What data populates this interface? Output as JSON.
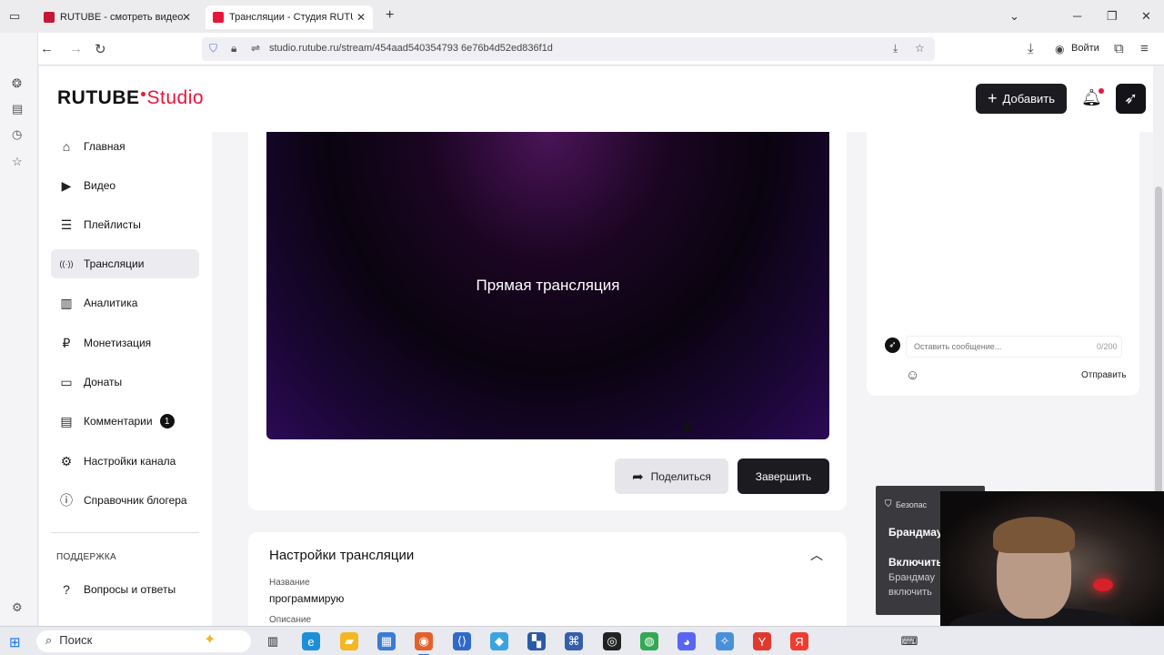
{
  "browser": {
    "tabs": [
      {
        "title": "RUTUBE - смотреть видео онл",
        "favicon_color": "#c61636"
      },
      {
        "title": "Трансляции - Студия RUTUBE",
        "favicon_color": "#ed143b"
      }
    ],
    "url": "studio.rutube.ru/stream/454aad540354793 6e76b4d52ed836f1d",
    "login_label": "Войти"
  },
  "header": {
    "logo_brand": "RUTUBE",
    "logo_product": "Studio",
    "add_label": "Добавить"
  },
  "sidebar": {
    "items": [
      {
        "label": "Главная",
        "icon": "⌂"
      },
      {
        "label": "Видео",
        "icon": "▶"
      },
      {
        "label": "Плейлисты",
        "icon": "☰"
      },
      {
        "label": "Трансляции",
        "icon": "((·))"
      },
      {
        "label": "Аналитика",
        "icon": "▥"
      },
      {
        "label": "Монетизация",
        "icon": "₽"
      },
      {
        "label": "Донаты",
        "icon": "▭"
      },
      {
        "label": "Комментарии",
        "icon": "▤",
        "badge": "1"
      },
      {
        "label": "Настройки канала",
        "icon": "⚙"
      },
      {
        "label": "Справочник блогера",
        "icon": "ⓘ"
      }
    ],
    "support_section": "ПОДДЕРЖКА",
    "support_items": [
      {
        "label": "Вопросы и ответы",
        "icon": "?"
      }
    ]
  },
  "player": {
    "title": "Прямая трансляция"
  },
  "actions": {
    "share_label": "Поделиться",
    "finish_label": "Завершить"
  },
  "settings": {
    "title": "Настройки трансляции",
    "name_label": "Название",
    "name_value": "программирую",
    "description_label": "Описание"
  },
  "chat": {
    "placeholder": "Оставить сообщение...",
    "counter": "0/200",
    "send_label": "Отправить"
  },
  "notification": {
    "line1": "Безопас",
    "line2": "Брандмау",
    "line3": "Включить",
    "line4": "Брандмау",
    "line5": "включить"
  },
  "taskbar": {
    "search_label": "Поиск"
  },
  "colors": {
    "brand_red": "#ed143b",
    "dark_button": "#1c1c20"
  }
}
